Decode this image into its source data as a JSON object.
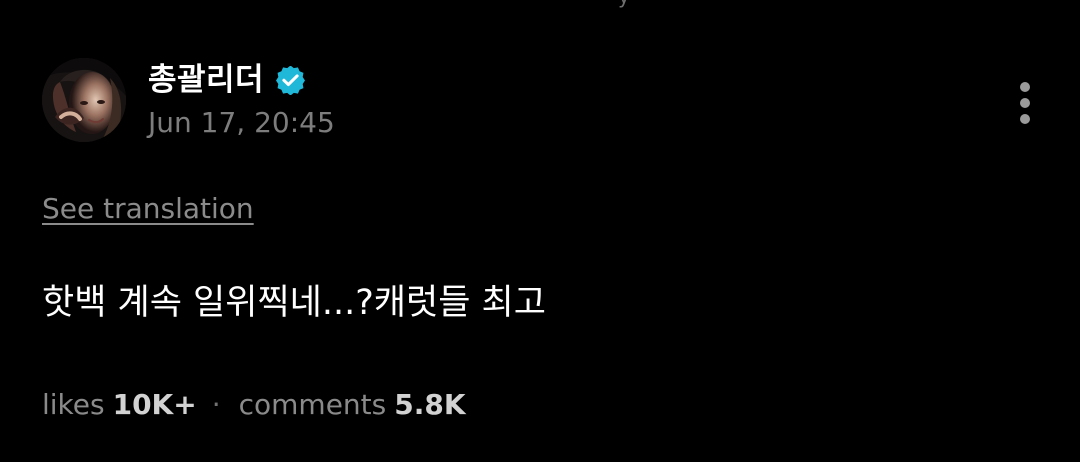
{
  "post": {
    "author": {
      "name": "총괄리더",
      "verified": true,
      "verified_color": "#20b8d8",
      "avatar_icon": "profile-photo"
    },
    "timestamp": "Jun 17, 20:45",
    "translation_link": "See translation",
    "text": "핫백 계속 일위찍네...?캐럿들 최고",
    "stats": {
      "likes_label": "likes",
      "likes_value": "10K+",
      "separator": "·",
      "comments_label": "comments",
      "comments_value": "5.8K"
    },
    "more_icon": "vertical-ellipsis-icon",
    "top_fragment": "y"
  },
  "colors": {
    "background": "#000000",
    "primary_text": "#ffffff",
    "secondary_text": "#7d7d7d",
    "muted_link": "#8b8b8b",
    "icon_gray": "#9b9b9b"
  }
}
